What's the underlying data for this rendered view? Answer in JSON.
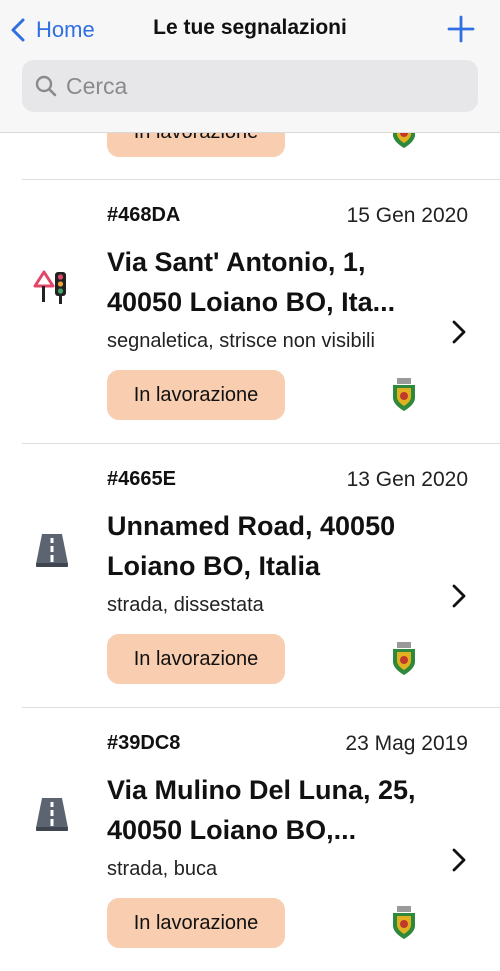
{
  "nav": {
    "back_label": "Home",
    "title": "Le tue segnalazioni",
    "add_icon": "plus-icon"
  },
  "search": {
    "placeholder": "Cerca",
    "value": ""
  },
  "partial_top": {
    "status": "In lavorazione"
  },
  "reports": [
    {
      "code": "#468DA",
      "date": "15 Gen 2020",
      "address": "Via Sant' Antonio, 1, 40050 Loiano BO, Ita...",
      "category": "segnaletica, strisce non visibili",
      "status": "In lavorazione",
      "icon": "traffic-sign-icon"
    },
    {
      "code": "#4665E",
      "date": "13 Gen 2020",
      "address": "Unnamed Road, 40050 Loiano BO, Italia",
      "category": "strada, dissestata",
      "status": "In lavorazione",
      "icon": "road-icon"
    },
    {
      "code": "#39DC8",
      "date": "23 Mag 2019",
      "address": "Via Mulino Del Luna, 25, 40050 Loiano BO,...",
      "category": "strada, buca",
      "status": "In lavorazione",
      "icon": "road-icon"
    }
  ],
  "colors": {
    "accent": "#2f6fe4",
    "status_bg": "#f8cdb0",
    "header_bg": "#f7f7f7"
  }
}
